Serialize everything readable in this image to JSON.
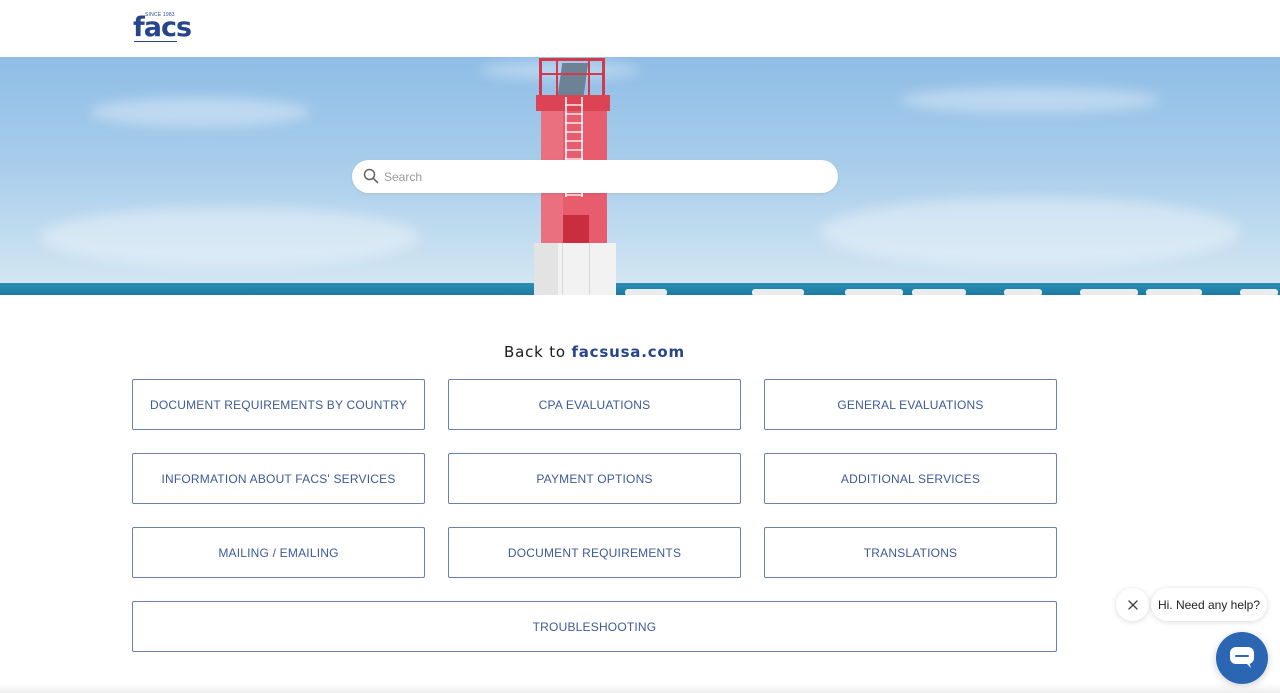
{
  "header": {
    "logo_text": "facs",
    "logo_tagline": "SINCE 1983"
  },
  "search": {
    "placeholder": "Search"
  },
  "back": {
    "prefix": "Back to",
    "link_label": "facsusa.com"
  },
  "categories": [
    {
      "label": "DOCUMENT REQUIREMENTS BY COUNTRY"
    },
    {
      "label": "CPA EVALUATIONS"
    },
    {
      "label": "GENERAL EVALUATIONS"
    },
    {
      "label": "INFORMATION ABOUT FACS' SERVICES"
    },
    {
      "label": "PAYMENT OPTIONS"
    },
    {
      "label": "ADDITIONAL SERVICES"
    },
    {
      "label": "MAILING / EMAILING"
    },
    {
      "label": "DOCUMENT REQUIREMENTS"
    },
    {
      "label": "TRANSLATIONS"
    },
    {
      "label": "TROUBLESHOOTING"
    }
  ],
  "chat": {
    "message": "Hi. Need any help?",
    "close_icon": "close-icon",
    "chat_icon": "chat-bubble-icon"
  },
  "colors": {
    "brand_blue": "#27458c",
    "button_text": "#3d5a96",
    "chat_blue": "#2b66b3"
  }
}
